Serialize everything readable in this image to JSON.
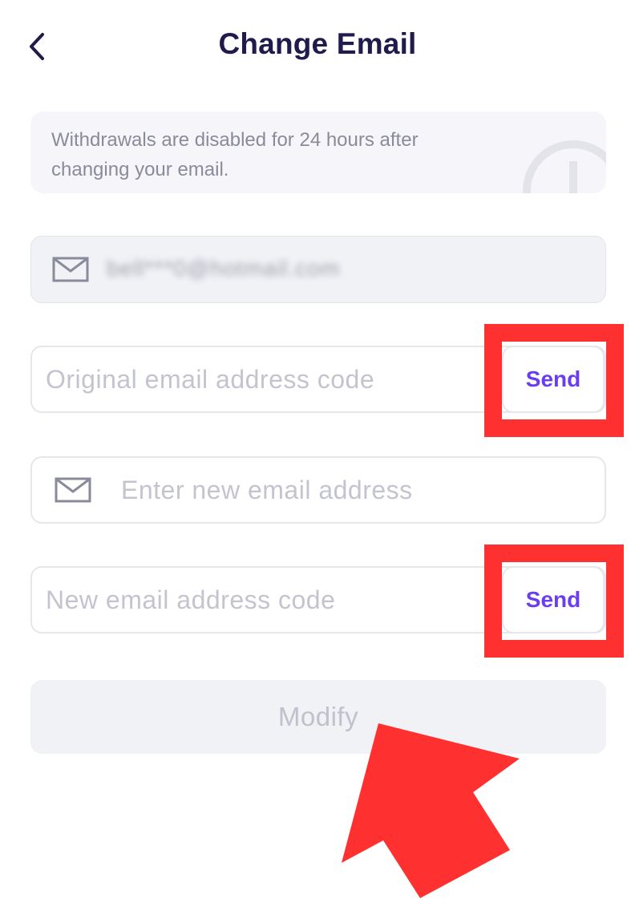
{
  "header": {
    "title": "Change Email"
  },
  "notice": {
    "text": "Withdrawals are disabled for 24 hours after changing your email."
  },
  "current_email": {
    "value": "bell***0@hotmail.com"
  },
  "original_code": {
    "placeholder": "Original email address code",
    "send_label": "Send"
  },
  "new_email": {
    "placeholder": "Enter new email address"
  },
  "new_code": {
    "placeholder": "New email address code",
    "send_label": "Send"
  },
  "modify_button": {
    "label": "Modify"
  },
  "colors": {
    "accent": "#6c3df0",
    "title": "#1f1b4d",
    "highlight": "#ff3030",
    "muted_text": "#8a8b9a",
    "field_bg": "#f1f2f6"
  },
  "icons": {
    "back": "chevron-left-icon",
    "notice": "info-icon",
    "mail": "envelope-icon"
  }
}
